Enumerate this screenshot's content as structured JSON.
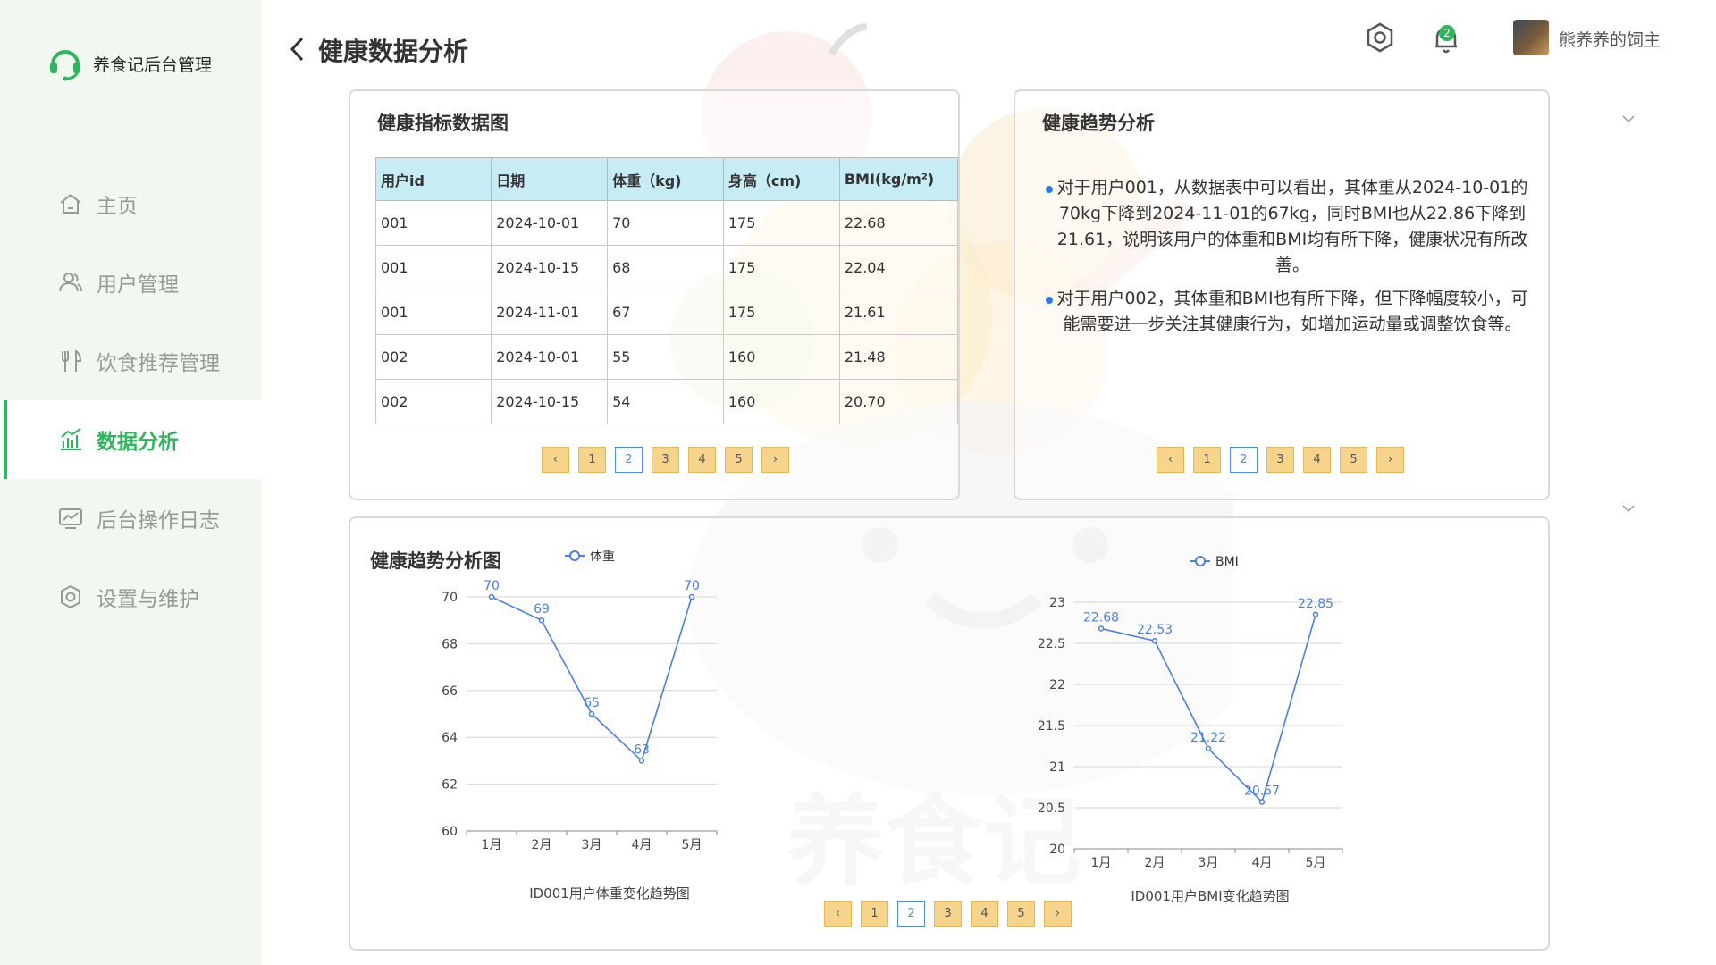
{
  "app": {
    "title": "养食记后台管理"
  },
  "sidebar": {
    "items": [
      {
        "label": "主页",
        "icon": "home-icon",
        "active": false
      },
      {
        "label": "用户管理",
        "icon": "users-icon",
        "active": false
      },
      {
        "label": "饮食推荐管理",
        "icon": "fork-knife-icon",
        "active": false
      },
      {
        "label": "数据分析",
        "icon": "chart-icon",
        "active": true
      },
      {
        "label": "后台操作日志",
        "icon": "log-icon",
        "active": false
      },
      {
        "label": "设置与维护",
        "icon": "settings-icon",
        "active": false
      }
    ]
  },
  "header": {
    "title": "健康数据分析",
    "notification_count": "2",
    "username": "熊养养的饲主"
  },
  "table_card": {
    "title": "健康指标数据图",
    "columns": [
      "用户id",
      "日期",
      "体重（kg)",
      "身高（cm)",
      "BMI(kg/m²)"
    ],
    "rows": [
      [
        "001",
        "2024-10-01",
        "70",
        "175",
        "22.68"
      ],
      [
        "001",
        "2024-10-15",
        "68",
        "175",
        "22.04"
      ],
      [
        "001",
        "2024-11-01",
        "67",
        "175",
        "21.61"
      ],
      [
        "002",
        "2024-10-01",
        "55",
        "160",
        "21.48"
      ],
      [
        "002",
        "2024-10-15",
        "54",
        "160",
        "20.70"
      ]
    ],
    "pager": {
      "prev": "‹",
      "pages": [
        "1",
        "2",
        "3",
        "4",
        "5"
      ],
      "current": "2",
      "next": "›"
    }
  },
  "trend_card": {
    "title": "健康趋势分析",
    "points": [
      "对于用户001，从数据表中可以看出，其体重从2024-10-01的70kg下降到2024-11-01的67kg，同时BMI也从22.86下降到21.61，说明该用户的体重和BMI均有所下降，健康状况有所改善。",
      "对于用户002，其体重和BMI也有所下降，但下降幅度较小，可能需要进一步关注其健康行为，如增加运动量或调整饮食等。"
    ],
    "pager": {
      "prev": "‹",
      "pages": [
        "1",
        "2",
        "3",
        "4",
        "5"
      ],
      "current": "2",
      "next": "›"
    }
  },
  "chart_card": {
    "title": "健康趋势分析图",
    "pager": {
      "prev": "‹",
      "pages": [
        "1",
        "2",
        "3",
        "4",
        "5"
      ],
      "current": "2",
      "next": "›"
    }
  },
  "colors": {
    "accent": "#2fb55c",
    "series": "#4a7fe0",
    "header_bg": "#c8ecf4",
    "pager": "#f6d48c"
  },
  "chart_data": [
    {
      "type": "line",
      "title": "",
      "caption": "ID001用户体重变化趋势图",
      "categories": [
        "1月",
        "2月",
        "3月",
        "4月",
        "5月"
      ],
      "series": [
        {
          "name": "体重",
          "values": [
            70,
            69,
            65,
            63,
            70
          ],
          "labels": [
            "70",
            "69",
            "65",
            "63",
            "70"
          ]
        }
      ],
      "yticks": [
        "60",
        "62",
        "64",
        "66",
        "68",
        "70"
      ],
      "ylim": [
        60,
        70
      ],
      "grid": true,
      "legend": "top"
    },
    {
      "type": "line",
      "title": "",
      "caption": "ID001用户BMI变化趋势图",
      "categories": [
        "1月",
        "2月",
        "3月",
        "4月",
        "5月"
      ],
      "series": [
        {
          "name": "BMI",
          "values": [
            22.68,
            22.53,
            21.22,
            20.57,
            22.85
          ],
          "labels": [
            "22.68",
            "22.53",
            "21.22",
            "20.57",
            "22.85"
          ]
        }
      ],
      "yticks": [
        "20",
        "20.5",
        "21",
        "21.5",
        "22",
        "22.5",
        "23"
      ],
      "ylim": [
        20,
        23
      ],
      "grid": true,
      "legend": "top"
    }
  ]
}
